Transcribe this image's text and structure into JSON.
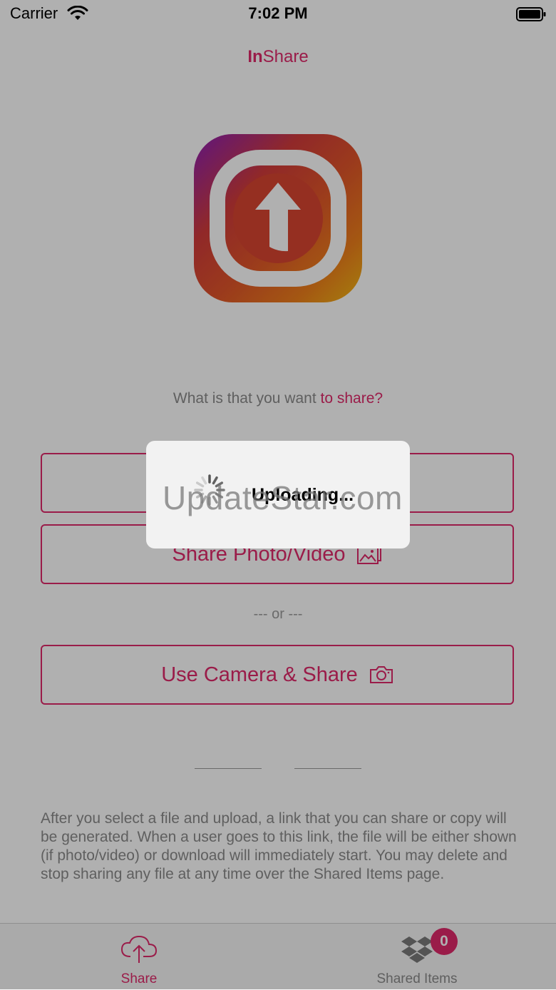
{
  "status_bar": {
    "carrier": "Carrier",
    "time": "7:02 PM"
  },
  "header": {
    "title_bold": "In",
    "title_rest": "Share"
  },
  "prompt": {
    "text": "What is that you want ",
    "accent": "to share?"
  },
  "buttons": {
    "share_photo_video": "Share Photo/Video",
    "or_separator": "--- or ---",
    "use_camera_share": "Use Camera & Share"
  },
  "info_text": "After you select a file and upload, a link that you can share or copy will be generated. When a user goes to this link, the file will be either shown (if photo/video) or download will immediately start. You may delete and stop sharing any file at any time over the Shared Items page.",
  "tab_bar": {
    "tabs": [
      {
        "label": "Share",
        "icon": "cloud-upload-icon",
        "selected": true
      },
      {
        "label": "Shared Items",
        "icon": "dropbox-icon",
        "badge": "0"
      }
    ]
  },
  "hud": {
    "text": "Uploading..."
  },
  "watermark": {
    "text": "UpdateStar.com"
  },
  "colors": {
    "accent": "#e0296a",
    "text_gray": "#8a8a8a",
    "overlay": "rgba(0,0,0,0.31)"
  }
}
